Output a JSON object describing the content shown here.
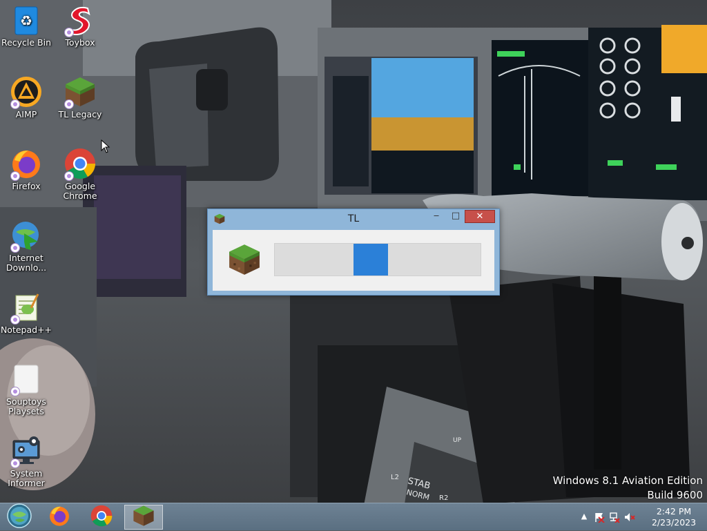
{
  "desktop": {
    "icons": [
      {
        "label": "Recycle Bin",
        "icon": "recycle-bin-icon"
      },
      {
        "label": "Toybox",
        "icon": "toybox-icon"
      },
      {
        "label": "AIMP",
        "icon": "aimp-icon"
      },
      {
        "label": "TL Legacy",
        "icon": "grass-block-icon"
      },
      {
        "label": "Firefox",
        "icon": "firefox-icon"
      },
      {
        "label": "Google Chrome",
        "icon": "chrome-icon"
      },
      {
        "label": "Internet Downlo...",
        "icon": "idm-icon"
      },
      {
        "label": "Notepad++",
        "icon": "notepad-plus-plus-icon"
      },
      {
        "label": "Souptoys Playsets",
        "icon": "blank-document-icon"
      },
      {
        "label": "System Informer",
        "icon": "system-informer-icon"
      }
    ]
  },
  "window": {
    "title": "TL",
    "minimize_glyph": "‒",
    "maximize_glyph": "□",
    "close_glyph": "✕",
    "progress_style": "marquee",
    "marquee_position": 0.46
  },
  "watermark": {
    "line1": "Windows 8.1 Aviation Edition",
    "line2": "Build 9600"
  },
  "taskbar": {
    "buttons": [
      {
        "name": "start",
        "icon": "start-orb-icon"
      },
      {
        "name": "firefox",
        "icon": "firefox-icon"
      },
      {
        "name": "chrome",
        "icon": "chrome-icon"
      },
      {
        "name": "tl-legacy",
        "icon": "grass-block-icon",
        "active": true
      }
    ],
    "tray": {
      "show_hidden": "▲",
      "icons": [
        "action-center-flag-icon",
        "network-icon",
        "volume-muted-icon"
      ]
    },
    "clock": {
      "time": "2:42 PM",
      "date": "2/23/2023"
    }
  },
  "colors": {
    "accent": "#2b80d8",
    "titlebar": "#8fb6d9",
    "close_button": "#c7504a",
    "taskbar": "#5a6f81"
  }
}
